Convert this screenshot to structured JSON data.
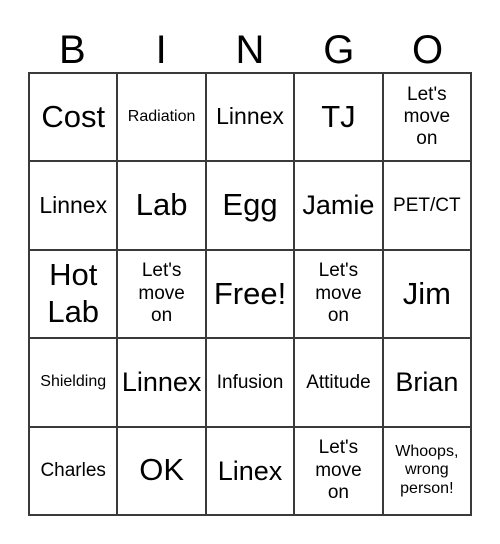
{
  "header": {
    "letters": [
      "B",
      "I",
      "N",
      "G",
      "O"
    ]
  },
  "grid": {
    "columns": 5,
    "rows": 5,
    "free_space_label": "Free!",
    "cells": [
      [
        {
          "text": "Cost",
          "size": "fs-xxl",
          "lines": 1
        },
        {
          "text": "Radiation",
          "size": "fs-sm",
          "lines": 1
        },
        {
          "text": "Linnex",
          "size": "fs-lg",
          "lines": 1
        },
        {
          "text": "TJ",
          "size": "fs-xxl",
          "lines": 1
        },
        {
          "text": "Let's\nmove\non",
          "size": "fs-md",
          "lines": 3
        }
      ],
      [
        {
          "text": "Linnex",
          "size": "fs-lg",
          "lines": 1
        },
        {
          "text": "Lab",
          "size": "fs-xxl",
          "lines": 1
        },
        {
          "text": "Egg",
          "size": "fs-xxl",
          "lines": 1
        },
        {
          "text": "Jamie",
          "size": "fs-xl",
          "lines": 1
        },
        {
          "text": "PET/CT",
          "size": "fs-md",
          "lines": 1
        }
      ],
      [
        {
          "text": "Hot\nLab",
          "size": "fs-xxl",
          "lines": 2
        },
        {
          "text": "Let's\nmove\non",
          "size": "fs-md",
          "lines": 3
        },
        {
          "text": "Free!",
          "size": "fs-xxl",
          "lines": 1
        },
        {
          "text": "Let's\nmove\non",
          "size": "fs-md",
          "lines": 3
        },
        {
          "text": "Jim",
          "size": "fs-xxl",
          "lines": 1
        }
      ],
      [
        {
          "text": "Shielding",
          "size": "fs-sm",
          "lines": 1
        },
        {
          "text": "Linnex",
          "size": "fs-xl",
          "lines": 1
        },
        {
          "text": "Infusion",
          "size": "fs-md",
          "lines": 1
        },
        {
          "text": "Attitude",
          "size": "fs-md",
          "lines": 1
        },
        {
          "text": "Brian",
          "size": "fs-xl",
          "lines": 1
        }
      ],
      [
        {
          "text": "Charles",
          "size": "fs-md",
          "lines": 1
        },
        {
          "text": "OK",
          "size": "fs-xxl",
          "lines": 1
        },
        {
          "text": "Linex",
          "size": "fs-xl",
          "lines": 1
        },
        {
          "text": "Let's\nmove\non",
          "size": "fs-md",
          "lines": 3
        },
        {
          "text": "Whoops,\nwrong\nperson!",
          "size": "fs-sm",
          "lines": 3
        }
      ]
    ]
  },
  "colors": {
    "background": "#ffffff",
    "text": "#000000",
    "border": "#3a3a3a"
  }
}
